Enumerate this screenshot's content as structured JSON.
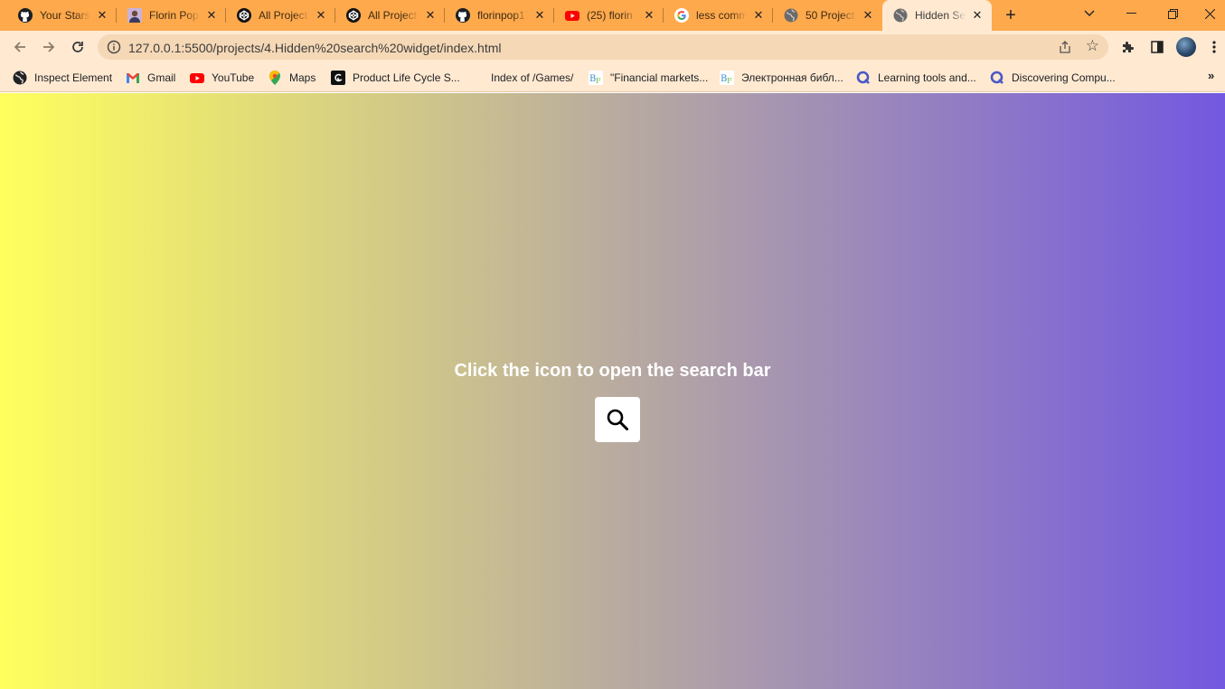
{
  "browser": {
    "tabs": [
      {
        "title": "Your Stars",
        "icon": "github-icon",
        "active": false
      },
      {
        "title": "Florin Pop",
        "icon": "profile-photo-icon",
        "active": false
      },
      {
        "title": "All Projects",
        "icon": "codepen-icon",
        "active": false
      },
      {
        "title": "All Projects",
        "icon": "codepen-icon",
        "active": false
      },
      {
        "title": "florinpop17",
        "icon": "github-icon",
        "active": false
      },
      {
        "title": "(25) florin",
        "icon": "youtube-icon",
        "active": false
      },
      {
        "title": "less comm",
        "icon": "google-icon",
        "active": false
      },
      {
        "title": "50 Projects",
        "icon": "globe-icon",
        "active": false
      },
      {
        "title": "Hidden Se",
        "icon": "globe-icon",
        "active": true
      }
    ],
    "url": "127.0.0.1:5500/projects/4.Hidden%20search%20widget/index.html",
    "bookmarks": [
      {
        "label": "Inspect Element",
        "icon": "globe-icon"
      },
      {
        "label": "Gmail",
        "icon": "gmail-icon"
      },
      {
        "label": "YouTube",
        "icon": "youtube-icon"
      },
      {
        "label": "Maps",
        "icon": "maps-icon"
      },
      {
        "label": "Product Life Cycle S...",
        "icon": "product-icon"
      },
      {
        "label": "Index of /Games/",
        "icon": ""
      },
      {
        "label": "\"Financial markets...",
        "icon": "bf-icon"
      },
      {
        "label": "Электронная библ...",
        "icon": "bf-icon"
      },
      {
        "label": "Learning tools and...",
        "icon": "q-icon"
      },
      {
        "label": "Discovering Compu...",
        "icon": "q-icon"
      }
    ],
    "colors": {
      "tab_strip": "#ffa94d",
      "toolbar": "#ffe9d1"
    }
  },
  "page": {
    "hint": "Click the icon to open the search bar",
    "gradient_start": "#ffff5d",
    "gradient_end": "#7358e0"
  }
}
